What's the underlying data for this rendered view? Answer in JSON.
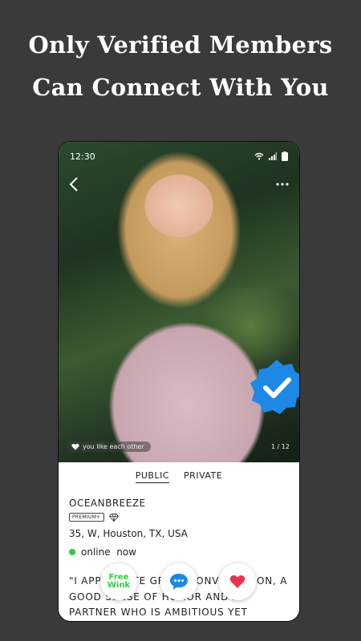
{
  "headline": {
    "line1": "Only Verified Members",
    "line2": "Can Connect With You"
  },
  "status_bar": {
    "time": "12:30",
    "icons": [
      "wifi-icon",
      "signal-icon",
      "battery-icon"
    ]
  },
  "photo": {
    "like_chip": "you like each other",
    "counter": "1 / 12",
    "icons": [
      "back-arrow-icon",
      "more-dots-icon",
      "verified-check-icon",
      "like-heart-icon"
    ]
  },
  "tabs": [
    "PUBLIC",
    "PRIVATE"
  ],
  "active_tab": "PUBLIC",
  "profile": {
    "username": "OCEANBREEZE",
    "premium_badge": "PREMIUM+",
    "diamond_icon": "diamond-icon",
    "details": "35, W, Houston, TX, USA",
    "status": "online  now",
    "bio": "\"I APPRECIATE GREAT CONVERSATION, A GOOD SENSE OF HUMOR AND A PARTNER WHO IS AMBITIOUS YET DOWN-TO-EARTH."
  },
  "actions": {
    "wink_line1": "Free",
    "wink_line2": "Wink",
    "chat_icon": "chat-bubble-icon",
    "heart_icon": "heart-icon"
  },
  "colors": {
    "background": "#3a3a3a",
    "online": "#2ecc40",
    "verified": "#1e88e5",
    "chat": "#1e88e5",
    "heart": "#e8334f"
  }
}
